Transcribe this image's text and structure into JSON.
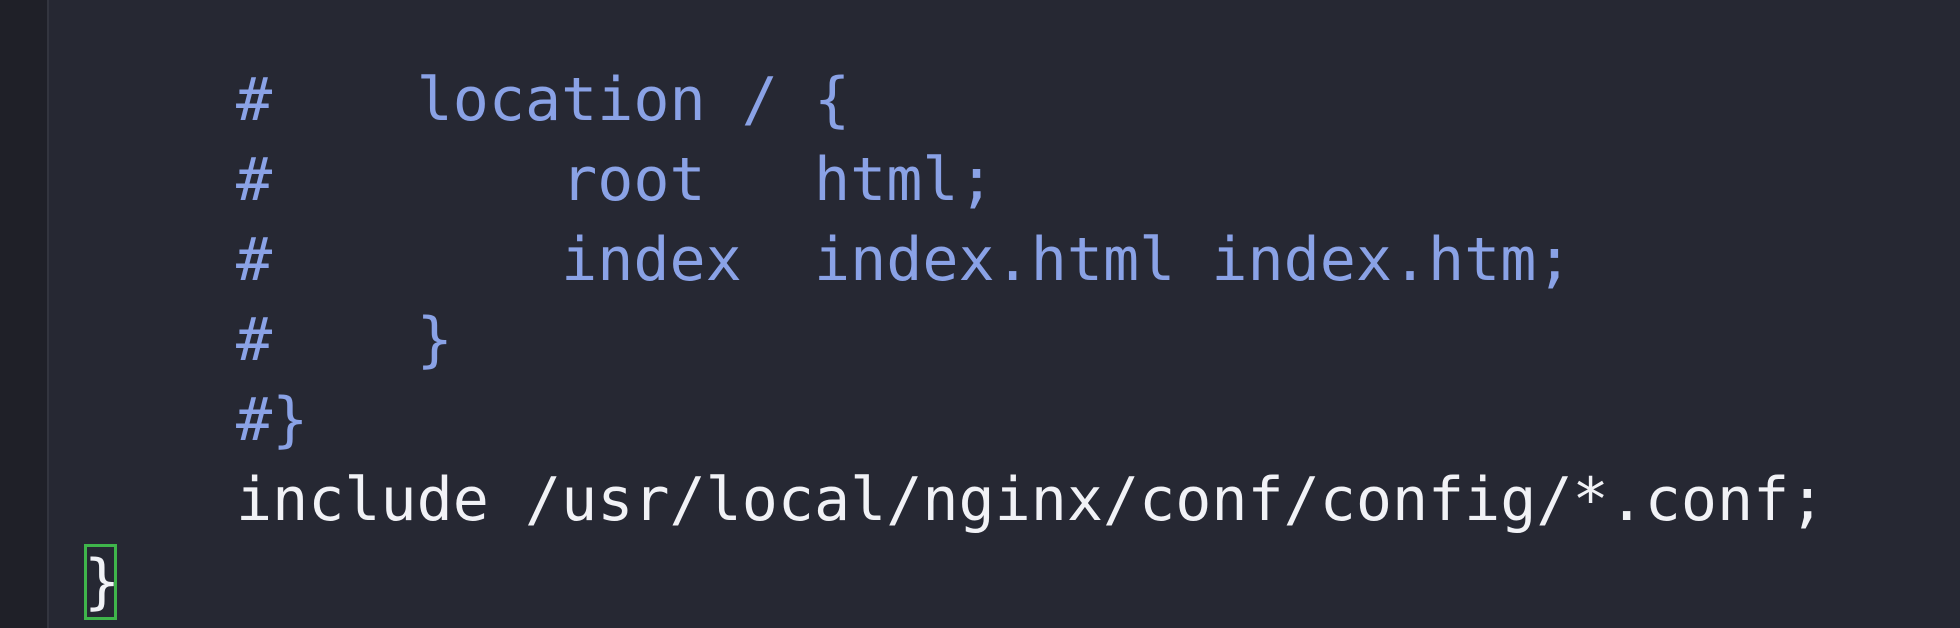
{
  "editor": {
    "lines": [
      "#    location / {",
      "#        root   html;",
      "#        index  index.html index.htm;",
      "#    }",
      "#}",
      "include /usr/local/nginx/conf/config/*.conf;"
    ],
    "cursor_char": "}"
  },
  "colors": {
    "background": "#262833",
    "gutter": "#1f2028",
    "comment": "#8aa2e6",
    "plain": "#f1f2f6",
    "cursor": "#3fb54b"
  }
}
